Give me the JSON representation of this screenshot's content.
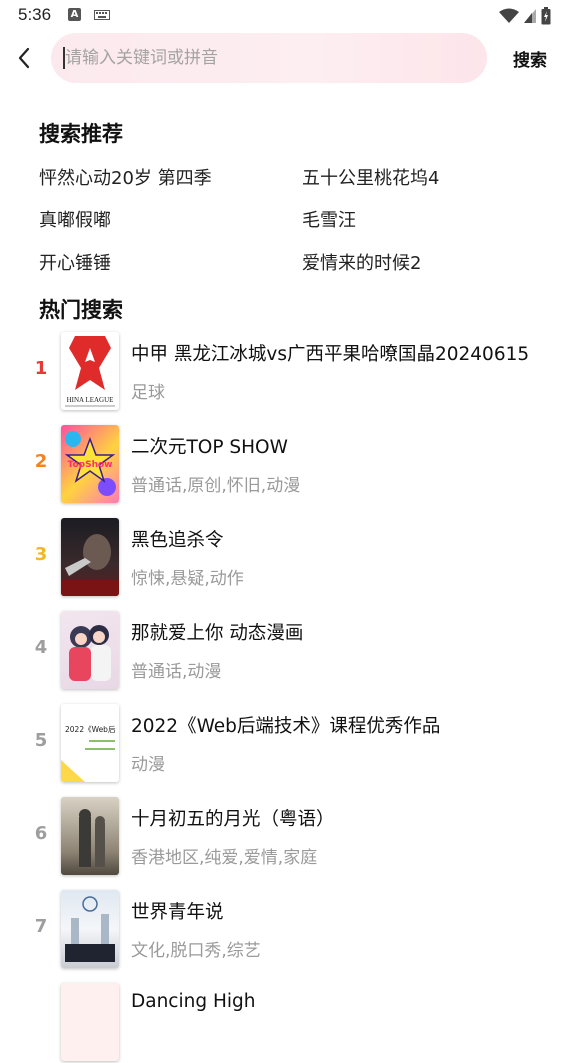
{
  "status_bar": {
    "time": "5:36",
    "a_glyph": "A"
  },
  "search": {
    "back_icon": "chevron-left-icon",
    "placeholder": "请输入关键词或拼音",
    "submit_label": "搜索"
  },
  "recommend": {
    "title": "搜索推荐",
    "items": [
      "怦然心动20岁 第四季",
      "五十公里桃花坞4",
      "真嘟假嘟",
      "毛雪汪",
      "开心锤锤",
      "爱情来的时候2"
    ]
  },
  "hot": {
    "title": "热门搜索",
    "rank_colors": {
      "1": "#e53935",
      "2": "#f5821f",
      "3": "#f2b824",
      "default": "#9e9e9e"
    },
    "items": [
      {
        "rank": "1",
        "title": "中甲 黑龙江冰城vs广西平果哈嘹国晶20240615",
        "tags": "足球",
        "thumb_text": "HINA LEAGUE"
      },
      {
        "rank": "2",
        "title": "二次元TOP SHOW",
        "tags": "普通话,原创,怀旧,动漫",
        "thumb_text": "TopShow"
      },
      {
        "rank": "3",
        "title": "黑色追杀令",
        "tags": "惊悚,悬疑,动作",
        "thumb_text": ""
      },
      {
        "rank": "4",
        "title": "那就爱上你 动态漫画",
        "tags": "普通话,动漫",
        "thumb_text": ""
      },
      {
        "rank": "5",
        "title": "2022《Web后端技术》课程优秀作品",
        "tags": "动漫",
        "thumb_text": "2022《Web后"
      },
      {
        "rank": "6",
        "title": "十月初五的月光（粤语）",
        "tags": "香港地区,纯爱,爱情,家庭",
        "thumb_text": ""
      },
      {
        "rank": "7",
        "title": "世界青年说",
        "tags": "文化,脱口秀,综艺",
        "thumb_text": ""
      },
      {
        "rank": "",
        "title": "Dancing High",
        "tags": "",
        "thumb_text": ""
      }
    ]
  }
}
